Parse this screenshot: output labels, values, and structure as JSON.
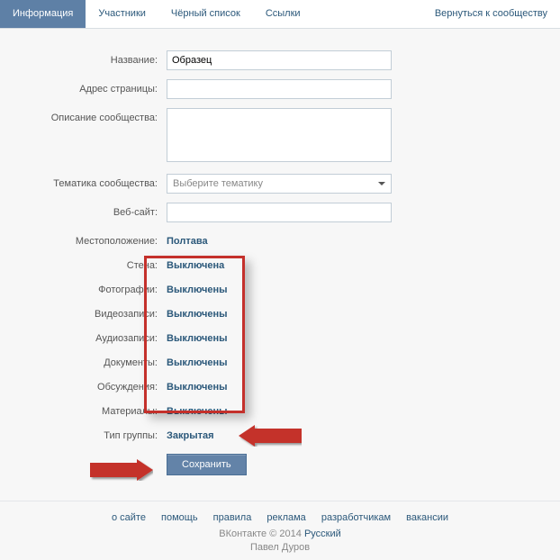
{
  "tabs": {
    "info": "Информация",
    "members": "Участники",
    "blacklist": "Чёрный список",
    "links": "Ссылки",
    "back": "Вернуться к сообществу"
  },
  "labels": {
    "name": "Название:",
    "address": "Адрес страницы:",
    "description": "Описание сообщества:",
    "theme": "Тематика сообщества:",
    "website": "Веб-сайт:",
    "location": "Местоположение:",
    "wall": "Стена:",
    "photos": "Фотографии:",
    "videos": "Видеозаписи:",
    "audios": "Аудиозаписи:",
    "docs": "Документы:",
    "discussions": "Обсуждения:",
    "materials": "Материалы:",
    "group_type": "Тип группы:"
  },
  "values": {
    "name": "Образец",
    "address": "",
    "description": "",
    "theme_placeholder": "Выберите тематику",
    "website": "",
    "location": "Полтава",
    "wall": "Выключена",
    "photos": "Выключены",
    "videos": "Выключены",
    "audios": "Выключены",
    "docs": "Выключены",
    "discussions": "Выключены",
    "materials": "Выключены",
    "group_type": "Закрытая"
  },
  "buttons": {
    "save": "Сохранить"
  },
  "footer": {
    "links": {
      "about": "о сайте",
      "help": "помощь",
      "rules": "правила",
      "ads": "реклама",
      "devs": "разработчикам",
      "jobs": "вакансии"
    },
    "brand": "ВКонтакте",
    "copyright": "© 2014",
    "language": "Русский",
    "author": "Павел Дуров"
  }
}
